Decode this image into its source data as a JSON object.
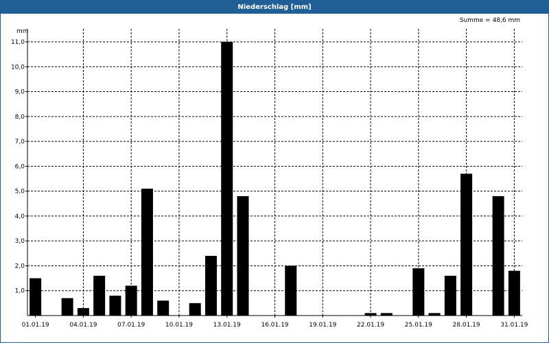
{
  "window": {
    "title": "Niederschlag [mm]"
  },
  "summary": {
    "text": "Summe = 48,6 mm"
  },
  "chart_data": {
    "type": "bar",
    "title": "Niederschlag [mm]",
    "ylabel": "mm",
    "xlabel": "",
    "ylim": [
      0,
      11.0
    ],
    "yticks": [
      1.0,
      2.0,
      3.0,
      4.0,
      5.0,
      6.0,
      7.0,
      8.0,
      9.0,
      10.0,
      11.0
    ],
    "ytick_labels": [
      "1,0",
      "2,0",
      "3,0",
      "4,0",
      "5,0",
      "6,0",
      "7,0",
      "8,0",
      "9,0",
      "10,0",
      "11,0"
    ],
    "x_tick_labels": [
      "01.01.19",
      "04.01.19",
      "07.01.19",
      "10.01.19",
      "13.01.19",
      "16.01.19",
      "19.01.19",
      "22.01.19",
      "25.01.19",
      "28.01.19",
      "31.01.19"
    ],
    "x_tick_days": [
      1,
      4,
      7,
      10,
      13,
      16,
      19,
      22,
      25,
      28,
      31
    ],
    "grid": true,
    "bar_color": "#000000",
    "days": [
      1,
      2,
      3,
      4,
      5,
      6,
      7,
      8,
      9,
      10,
      11,
      12,
      13,
      14,
      15,
      16,
      17,
      18,
      19,
      20,
      21,
      22,
      23,
      24,
      25,
      26,
      27,
      28,
      29,
      30,
      31
    ],
    "values": [
      1.5,
      0,
      0.7,
      0.3,
      1.6,
      0.8,
      1.2,
      5.1,
      0.6,
      0,
      0.5,
      2.4,
      11.0,
      4.8,
      0,
      0,
      2.0,
      0,
      0,
      0,
      0,
      0.1,
      0.1,
      0,
      1.9,
      0.1,
      1.6,
      5.7,
      0,
      4.8,
      1.8
    ]
  }
}
